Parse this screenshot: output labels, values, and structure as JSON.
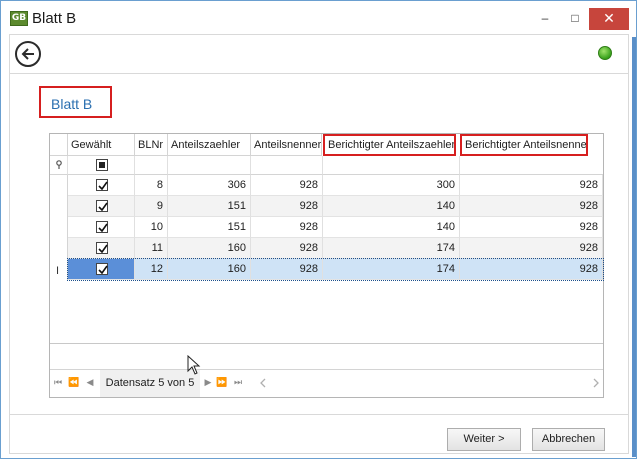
{
  "window": {
    "app_icon_text": "GB",
    "title": "Blatt B",
    "minimize_glyph": "–",
    "maximize_glyph": "□",
    "close_glyph": "✕"
  },
  "nav": {
    "back_icon": "arrow-left-circle-icon",
    "status_icon": "green-status-dot-icon",
    "status_color": "#38a11b"
  },
  "page": {
    "title": "Blatt B"
  },
  "grid": {
    "columns": [
      "Gewählt",
      "BLNr",
      "Anteilszaehler",
      "Anteilsnenner",
      "Berichtigter Anteilszaehler",
      "Berichtigter Anteilsnenner"
    ],
    "rows": [
      {
        "selected": true,
        "blnr": "8",
        "anteilszaehler": "306",
        "anteilsnenner": "928",
        "ber_zaehler": "300",
        "ber_nenner": "928"
      },
      {
        "selected": true,
        "blnr": "9",
        "anteilszaehler": "151",
        "anteilsnenner": "928",
        "ber_zaehler": "140",
        "ber_nenner": "928"
      },
      {
        "selected": true,
        "blnr": "10",
        "anteilszaehler": "151",
        "anteilsnenner": "928",
        "ber_zaehler": "140",
        "ber_nenner": "928"
      },
      {
        "selected": true,
        "blnr": "11",
        "anteilszaehler": "160",
        "anteilsnenner": "928",
        "ber_zaehler": "174",
        "ber_nenner": "928"
      },
      {
        "selected": true,
        "blnr": "12",
        "anteilszaehler": "160",
        "anteilsnenner": "928",
        "ber_zaehler": "174",
        "ber_nenner": "928"
      }
    ],
    "current_row_index": 4,
    "highlight_color": "#d61f1f",
    "selection_color": "#cfe3f6"
  },
  "navigator": {
    "record_text": "Datensatz 5 von 5"
  },
  "footer": {
    "next_label": "Weiter >",
    "cancel_label": "Abbrechen"
  }
}
